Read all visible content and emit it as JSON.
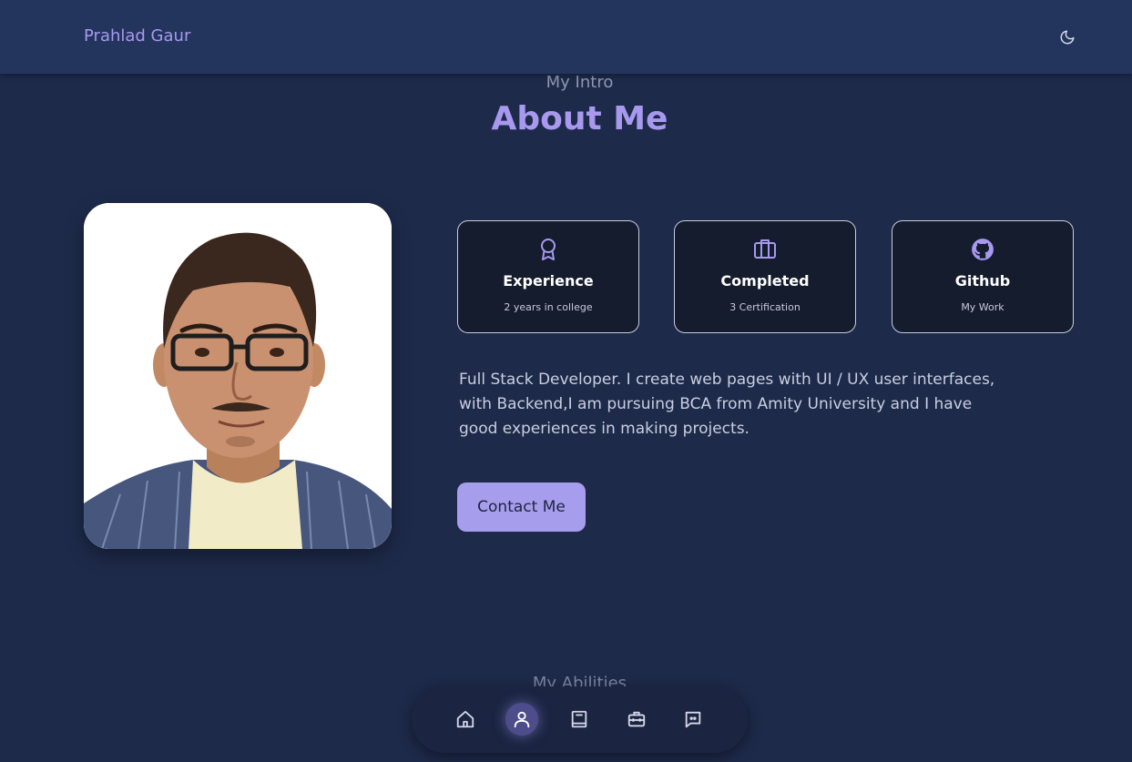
{
  "header": {
    "brand": "Prahlad Gaur",
    "theme_icon": "moon-icon"
  },
  "section": {
    "subtitle": "My Intro",
    "title": "About Me"
  },
  "profile_photo": {
    "alt": "Prahlad Gaur portrait"
  },
  "cards": [
    {
      "icon": "award-icon",
      "title": "Experience",
      "subtitle": "2 years in college"
    },
    {
      "icon": "briefcase-icon",
      "title": "Completed",
      "subtitle": "3 Certification"
    },
    {
      "icon": "github-icon",
      "title": "Github",
      "subtitle": "My Work"
    }
  ],
  "description": "Full Stack Developer. I create web pages with UI / UX user interfaces, with Backend,I am pursuing BCA from Amity University and I have good experiences in making projects.",
  "contact_button": "Contact Me",
  "next_section_subtitle": "My Abilities",
  "bottom_nav": {
    "items": [
      {
        "icon": "home-icon",
        "active": false
      },
      {
        "icon": "user-icon",
        "active": true
      },
      {
        "icon": "book-icon",
        "active": false
      },
      {
        "icon": "toolbox-icon",
        "active": false
      },
      {
        "icon": "message-icon",
        "active": false
      }
    ]
  },
  "colors": {
    "background": "#1d2a4a",
    "header": "#24355d",
    "accent": "#a899ef",
    "button": "#a79ded",
    "card_bg": "#151c2e"
  }
}
